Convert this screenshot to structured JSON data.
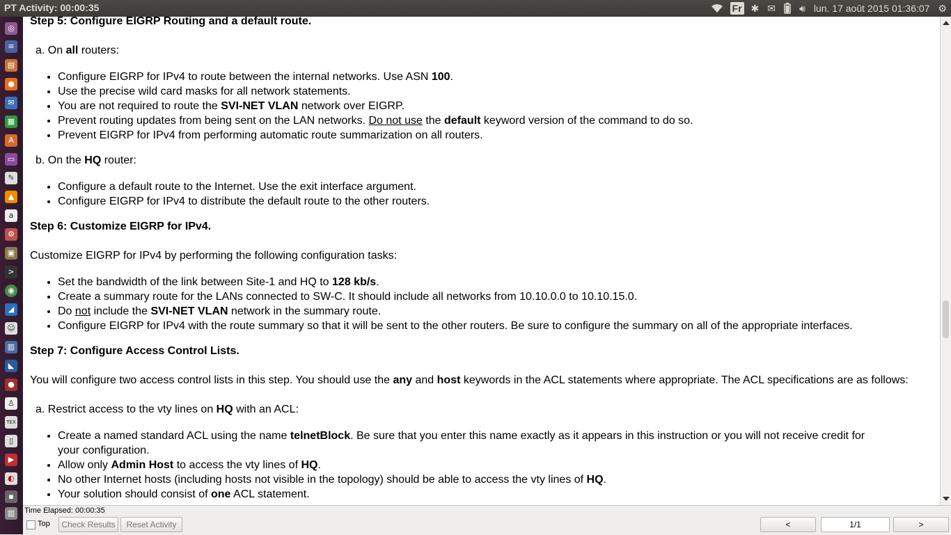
{
  "topbar": {
    "title": "PT Activity: 00:00:35",
    "keyboard_layout": "Fr",
    "datetime": "lun. 17 août 2015 01:36:07"
  },
  "doc": {
    "step5": {
      "heading": "Step 5: Configure EIGRP Routing and a default route.",
      "a_label": "a. On ",
      "a_bold": "all",
      "a_rest": " routers:",
      "a_items": [
        [
          "Configure EIGRP for IPv4 to route between the internal networks. Use ASN ",
          "100",
          "."
        ],
        [
          "Use the precise wild card masks for all network statements."
        ],
        [
          "You are not required to route the ",
          "SVI-NET VLAN",
          " network over EIGRP."
        ],
        [
          "Prevent routing updates from being sent on the LAN networks.  ",
          "Do not use",
          " the ",
          "default",
          " keyword version of the command to do so."
        ],
        [
          "Prevent EIGRP for IPv4 from performing automatic route summarization on all routers."
        ]
      ],
      "b_label": "b. On the ",
      "b_bold": "HQ",
      "b_rest": " router:",
      "b_items": [
        "Configure a default route to the Internet. Use the exit interface argument.",
        "Configure EIGRP for IPv4 to distribute the default route to the other routers."
      ]
    },
    "step6": {
      "heading": "Step 6: Customize EIGRP for IPv4.",
      "intro": "Customize EIGRP for IPv4 by performing the following configuration tasks:",
      "items": [
        [
          "Set the bandwidth of the link between Site-1 and HQ to ",
          "128 kb/s",
          "."
        ],
        [
          "Create a summary route for the LANs connected to SW-C. It should include all networks from 10.10.0.0 to 10.10.15.0."
        ],
        [
          "Do ",
          "not",
          " include the ",
          "SVI-NET VLAN",
          " network in the summary route."
        ],
        [
          "Configure EIGRP for IPv4 with the route summary so that it will be sent to the other routers. Be sure to configure the summary on all of the appropriate interfaces."
        ]
      ]
    },
    "step7": {
      "heading": "Step 7: Configure Access Control Lists.",
      "intro": [
        "You will configure two access control lists in this step. You should use the ",
        "any",
        " and ",
        "host",
        " keywords in the ACL statements where appropriate. The ACL specifications are as follows:"
      ],
      "a_label": "a.  Restrict access to the vty lines on ",
      "a_bold": "HQ",
      "a_rest": " with an ACL:",
      "items": [
        [
          "Create a named standard ACL using the name ",
          "telnetBlock",
          ". Be sure that you enter this name exactly as it appears in this instruction or you will not receive credit for your configuration."
        ],
        [
          "Allow only ",
          "Admin Host",
          " to access the vty lines of ",
          "HQ",
          "."
        ],
        [
          "No other Internet hosts (including hosts not visible in the topology) should be able to access the vty lines of ",
          "HQ",
          "."
        ],
        [
          "Your solution should consist of ",
          "one",
          " ACL statement."
        ]
      ]
    }
  },
  "bottom": {
    "time_elapsed": "Time Elapsed: 00:00:35",
    "top_label": "Top",
    "check_results": "Check Results",
    "reset_activity": "Reset Activity",
    "prev": "<",
    "page": "1/1",
    "next": ">"
  }
}
